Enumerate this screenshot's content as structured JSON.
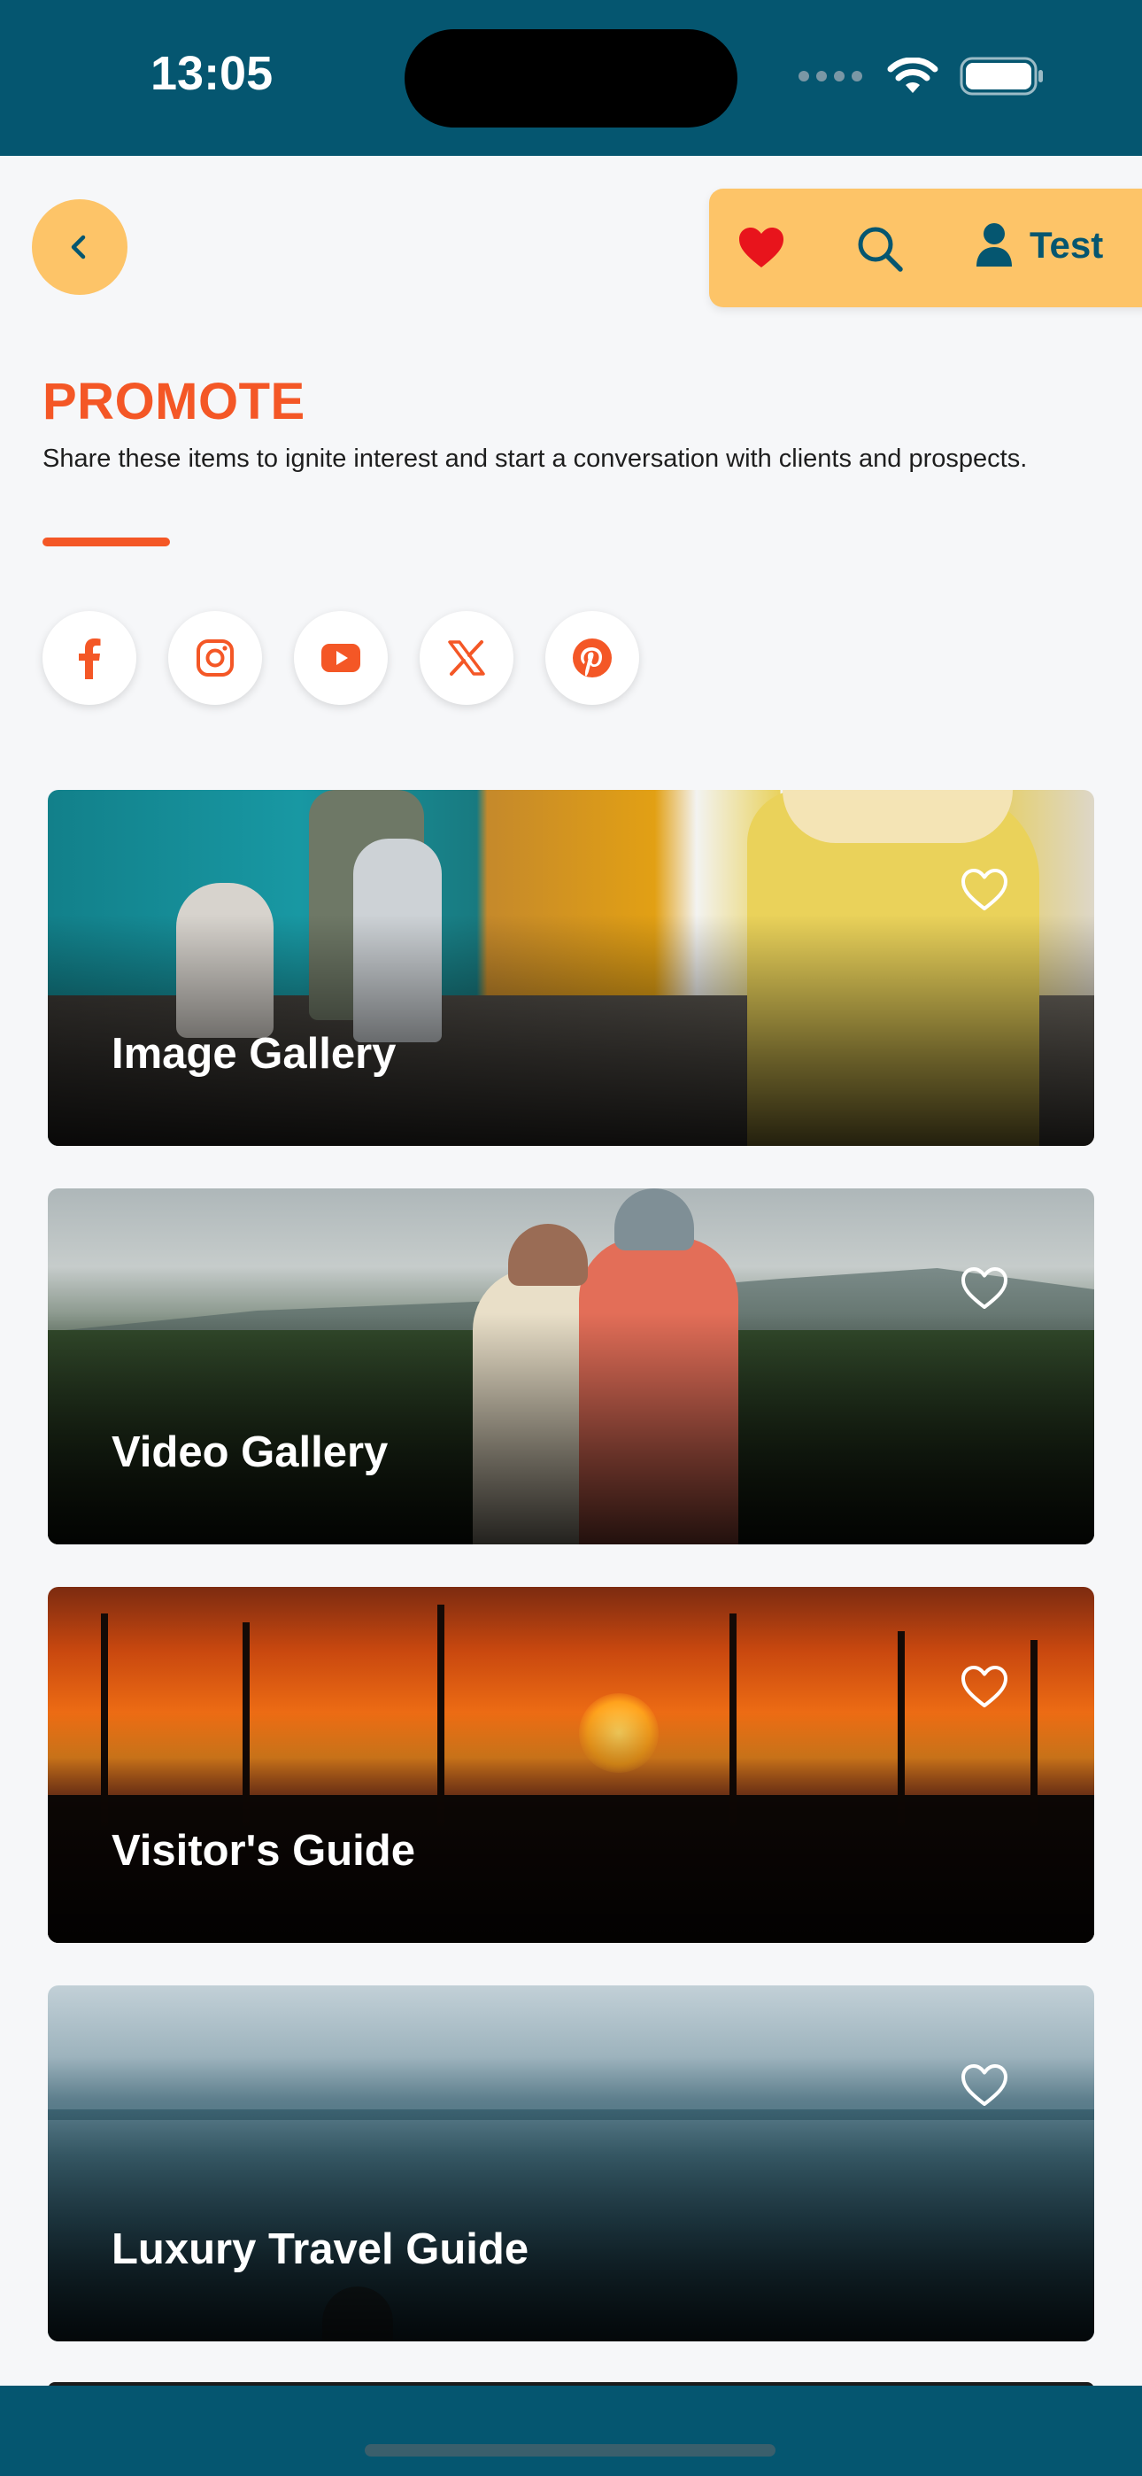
{
  "status_bar": {
    "time": "13:05"
  },
  "colors": {
    "brand_teal": "#055670",
    "accent_orange": "#f45726",
    "toolbar_yellow": "#fdc468",
    "favorite_red": "#e8141c"
  },
  "top_nav": {
    "back_icon": "chevron-left-icon",
    "toolbar": {
      "favorites_icon": "heart-filled-icon",
      "search_icon": "search-icon",
      "user_icon": "user-icon",
      "user_label": "Test"
    }
  },
  "header": {
    "title": "PROMOTE",
    "description": "Share these items to ignite interest and start a conversation with clients and prospects."
  },
  "social": [
    {
      "name": "facebook",
      "icon": "facebook-icon"
    },
    {
      "name": "instagram",
      "icon": "instagram-icon"
    },
    {
      "name": "youtube",
      "icon": "youtube-icon"
    },
    {
      "name": "x",
      "icon": "x-icon"
    },
    {
      "name": "pinterest",
      "icon": "pinterest-icon"
    }
  ],
  "cards": [
    {
      "title": "Image Gallery",
      "favorite_icon": "heart-outline-icon"
    },
    {
      "title": "Video Gallery",
      "favorite_icon": "heart-outline-icon"
    },
    {
      "title": "Visitor's Guide",
      "favorite_icon": "heart-outline-icon"
    },
    {
      "title": "Luxury Travel Guide",
      "favorite_icon": "heart-outline-icon"
    }
  ]
}
